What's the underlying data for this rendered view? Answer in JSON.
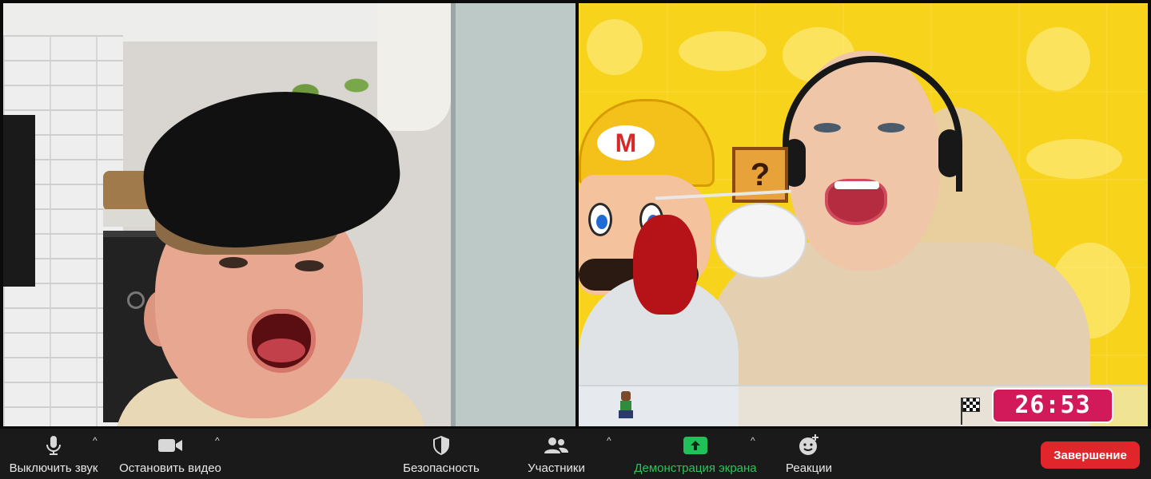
{
  "timer": {
    "value": "26:53"
  },
  "badge": {
    "letter": "M"
  },
  "qblock": {
    "glyph": "?"
  },
  "toolbar": {
    "mute_label": "Выключить звук",
    "video_label": "Остановить видео",
    "security_label": "Безопасность",
    "participants_label": "Участники",
    "share_label": "Демонстрация экрана",
    "reactions_label": "Реакции",
    "end_label": "Завершение",
    "caret": "^"
  },
  "colors": {
    "share_accent": "#21c15a",
    "end_button": "#e0262b",
    "timer_bg": "#d21a5a",
    "right_bg": "#f7d31c"
  },
  "icons": {
    "mute": "microphone-icon",
    "video": "video-camera-icon",
    "security": "shield-icon",
    "participants": "people-icon",
    "share": "share-screen-arrow-icon",
    "reactions": "smiley-add-icon"
  }
}
